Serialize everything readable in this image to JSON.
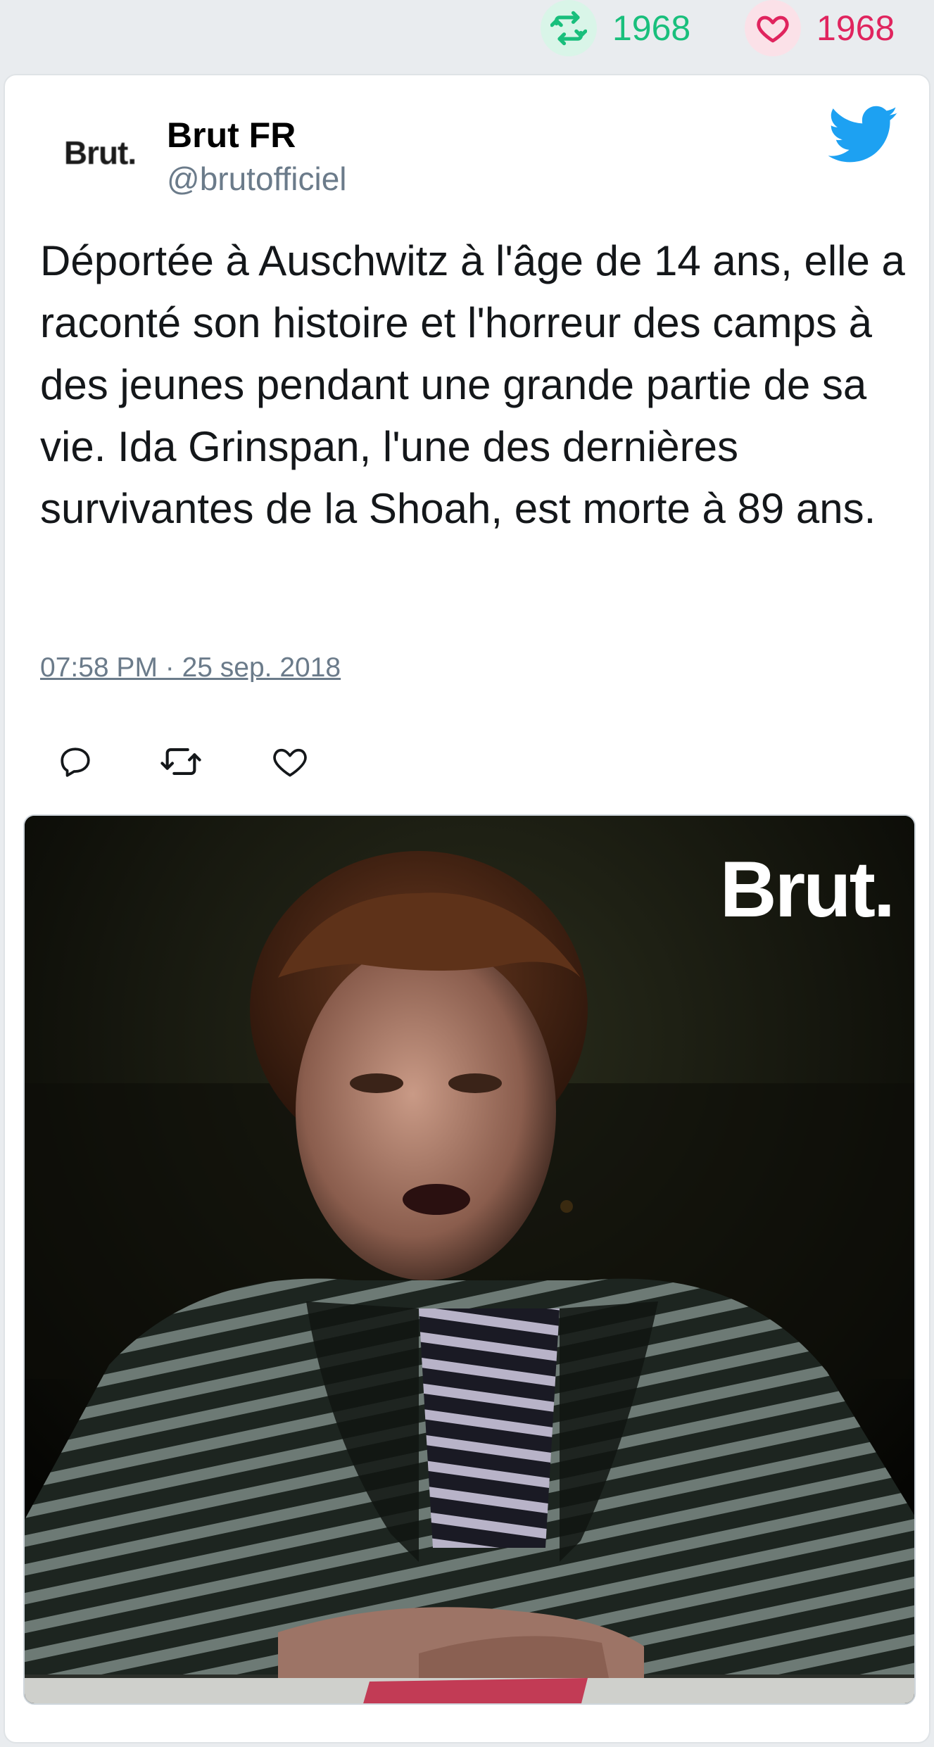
{
  "stats": {
    "retweets": "1968",
    "likes": "1968",
    "retweet_icon": "retweet-icon",
    "like_icon": "heart-icon",
    "retweet_color": "#19bf7c",
    "like_color": "#e0245e"
  },
  "tweet": {
    "author_name": "Brut FR",
    "author_handle": "@brutofficiel",
    "avatar_text": "Brut.",
    "text": "Déportée à Auschwitz à l'âge de 14 ans, elle a raconté son histoire et l'horreur des camps à des jeunes pendant une grande partie de sa vie. Ida Grinspan, l'une des dernières survivantes de la Shoah, est morte à 89 ans.",
    "timestamp": "07:58 PM · 25 sep. 2018",
    "brand_icon": "twitter-bird-icon",
    "brand_color": "#1da1f2"
  },
  "actions": {
    "reply_icon": "reply-icon",
    "retweet_icon": "retweet-icon",
    "like_icon": "heart-icon"
  },
  "media": {
    "watermark": "Brut."
  }
}
